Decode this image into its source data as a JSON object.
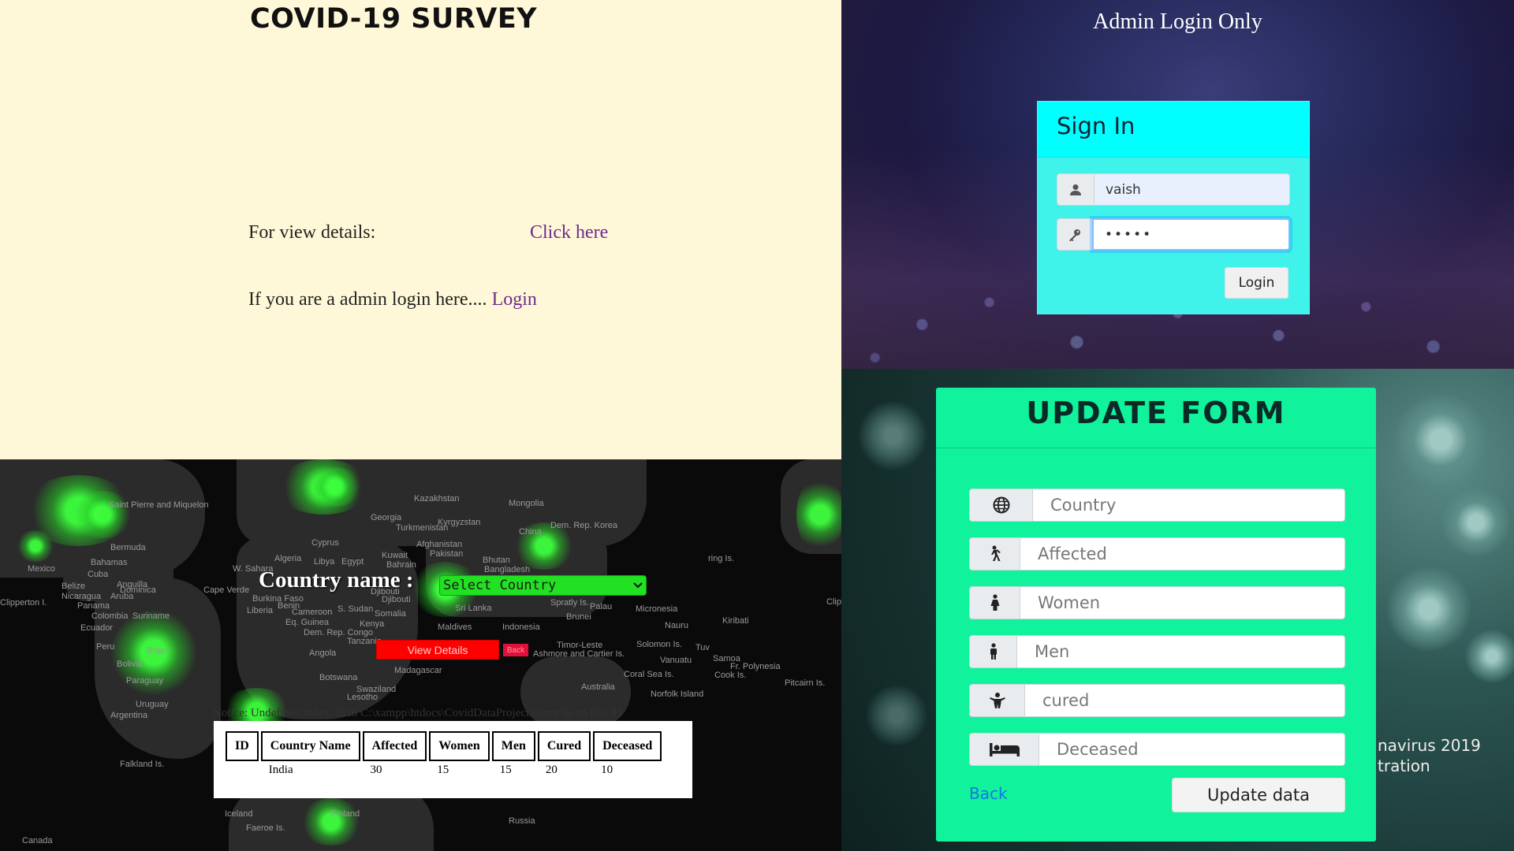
{
  "survey": {
    "title": "COVID-19 SURVEY",
    "view_label": "For view details:",
    "view_link": "Click here",
    "admin_text": "If you are a admin login here....",
    "admin_link": "Login"
  },
  "admin_login": {
    "heading": "Admin Login Only",
    "card_title": "Sign In",
    "username_value": "vaish",
    "password_value": "•••••",
    "login_button": "Login",
    "icons": {
      "user": "user-icon",
      "key": "key-icon"
    }
  },
  "country_view": {
    "country_label": "Country name :",
    "select_value": "Select Country",
    "view_button": "View Details",
    "back_button": "Back",
    "notice": "Notice: Undefined index: id in C:\\xampp\\htdocs\\CovidDataProject\\user.php on line 93",
    "table": {
      "headers": [
        "ID",
        "Country Name",
        "Affected",
        "Women",
        "Men",
        "Cured",
        "Deceased"
      ],
      "rows": [
        [
          "",
          "India",
          "30",
          "15",
          "15",
          "20",
          "10"
        ]
      ]
    },
    "map_labels": [
      "Kazakhstan",
      "Kyrgyzstan",
      "Mongolia",
      "China",
      "Dem. Rep. Korea",
      "Afghanistan",
      "Pakistan",
      "Bhutan",
      "Bangladesh",
      "Saint Pierre and Miquelon",
      "Bermuda",
      "Bahamas",
      "Cuba",
      "Mexico",
      "Belize",
      "Anguilla",
      "Dominica",
      "Nicaragua",
      "Aruba",
      "Panama",
      "Colombia",
      "Suriname",
      "Ecuador",
      "Peru",
      "Brazil",
      "Bolivia",
      "Paraguay",
      "Uruguay",
      "Argentina",
      "Falkland Is.",
      "Clipperton I.",
      "Cape Verde",
      "W. Sahara",
      "Algeria",
      "Libya",
      "Egypt",
      "Kuwait",
      "Bahrain",
      "Burkina Faso",
      "Benin",
      "Liberia",
      "Cameroon",
      "Eq. Guinea",
      "S. Sudan",
      "Djibouti",
      "Somalia",
      "Kenya",
      "Dem. Rep. Congo",
      "Tanzania",
      "Angola",
      "Madagascar",
      "Botswana",
      "Swaziland",
      "Lesotho",
      "Maldives",
      "Sri Lanka",
      "Indonesia",
      "Palau",
      "Micronesia",
      "Nauru",
      "Kiribati",
      "Solomon Is.",
      "Vanuatu",
      "Samoa",
      "Fr. Polynesia",
      "Cook Is.",
      "Coral Sea Is.",
      "Norfolk Island",
      "Pitcairn Is.",
      "Timor-Leste",
      "Ashmore and Cartier Is.",
      "Australia",
      "Iceland",
      "Faeroe Is.",
      "Finland",
      "Russia",
      "Canada",
      "Georgia",
      "Turkmenistan",
      "Cyprus",
      "Djibouti",
      "Spratly Is.",
      "Brunei",
      "Tuv",
      "Clip",
      "ring Is."
    ],
    "icons": {
      "chevron": "chevron-down-icon"
    }
  },
  "update_form": {
    "title": "UPDATE FORM",
    "fields": [
      {
        "placeholder": "Country",
        "icon": "globe-icon"
      },
      {
        "placeholder": "Affected",
        "icon": "walking-person-icon"
      },
      {
        "placeholder": "Women",
        "icon": "female-icon"
      },
      {
        "placeholder": "Men",
        "icon": "male-icon"
      },
      {
        "placeholder": "cured",
        "icon": "child-icon"
      },
      {
        "placeholder": "Deceased",
        "icon": "bed-icon"
      }
    ],
    "back_link": "Back",
    "update_button": "Update data",
    "side_text": [
      "navirus 2019",
      "tration"
    ]
  },
  "colors": {
    "survey_bg": "#fff8d8",
    "link_purple": "#6b2a8c",
    "signin_header": "#00ffff",
    "signin_body": "#3ff2ea",
    "select_green": "#22e022",
    "view_red": "#ff0000",
    "form_green": "#10f29b"
  }
}
